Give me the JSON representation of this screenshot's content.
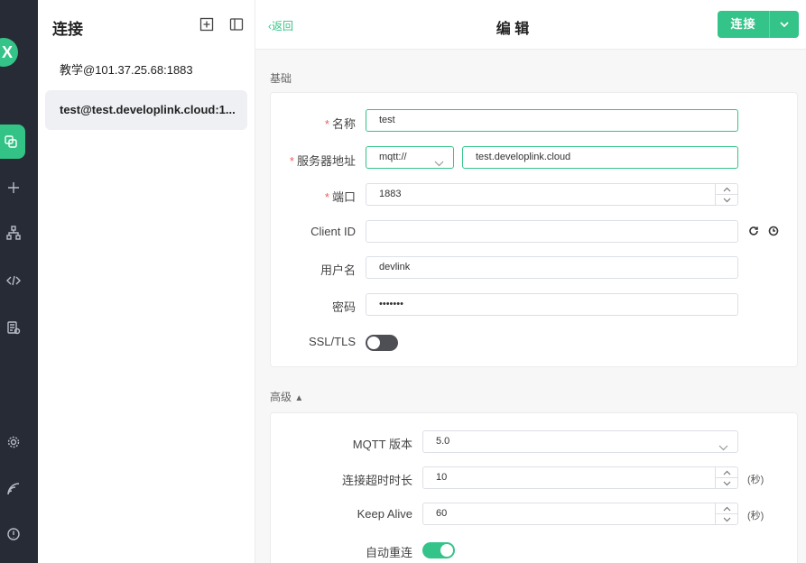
{
  "colors": {
    "accent": "#34c388",
    "rail_bg": "#262b35",
    "required": "#f15b5b"
  },
  "rail": {
    "icons": [
      "logo-icon",
      "connections-icon",
      "add-icon",
      "topology-icon",
      "script-icon",
      "log-icon",
      "settings-icon",
      "subscribe-icon",
      "about-icon"
    ],
    "logo_text": "X"
  },
  "connections": {
    "title": "连接",
    "items": [
      {
        "label": "教学@101.37.25.68:1883",
        "selected": false
      },
      {
        "label": "test@test.developlink.cloud:1...",
        "selected": true
      }
    ]
  },
  "header": {
    "back_label": "返回",
    "title": "编 辑",
    "connect_label": "连接"
  },
  "basic": {
    "section_title": "基础",
    "name_label": "名称",
    "name_value": "test",
    "host_label": "服务器地址",
    "protocol_value": "mqtt://",
    "host_value": "test.developlink.cloud",
    "port_label": "端口",
    "port_value": "1883",
    "client_id_label": "Client ID",
    "client_id_value": "",
    "username_label": "用户名",
    "username_value": "devlink",
    "password_label": "密码",
    "password_value": "•••••••",
    "ssl_label": "SSL/TLS",
    "ssl_enabled": false
  },
  "advanced": {
    "section_title": "高级",
    "mqtt_version_label": "MQTT 版本",
    "mqtt_version_value": "5.0",
    "timeout_label": "连接超时时长",
    "timeout_value": "10",
    "timeout_unit": "(秒)",
    "keepalive_label": "Keep Alive",
    "keepalive_value": "60",
    "keepalive_unit": "(秒)",
    "reconnect_label": "自动重连",
    "reconnect_enabled": true
  }
}
